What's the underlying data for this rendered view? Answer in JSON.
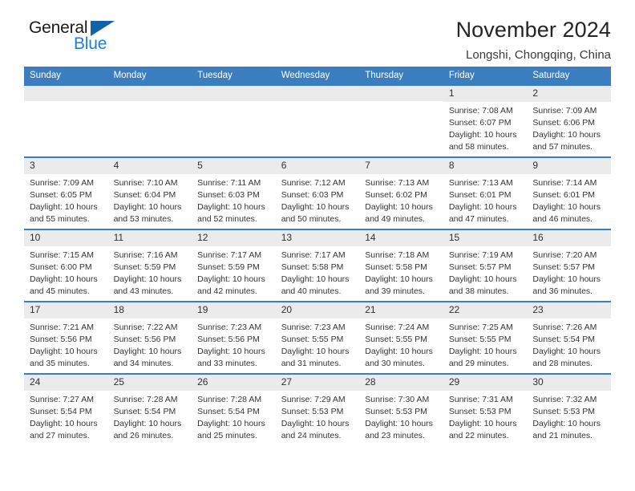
{
  "brand": {
    "name_part1": "General",
    "name_part2": "Blue",
    "triangle_color": "#1262ab",
    "blue_text_color": "#1f7fd0"
  },
  "header": {
    "title": "November 2024",
    "location": "Longshi, Chongqing, China"
  },
  "theme": {
    "header_blue": "#3b7ec0",
    "daynum_band": "#ebebeb",
    "text": "#333333"
  },
  "weekday_headers": [
    "Sunday",
    "Monday",
    "Tuesday",
    "Wednesday",
    "Thursday",
    "Friday",
    "Saturday"
  ],
  "labels": {
    "sunrise_prefix": "Sunrise: ",
    "sunset_prefix": "Sunset: ",
    "daylight_prefix": "Daylight: "
  },
  "weeks": [
    [
      {
        "day": "",
        "sunrise": "",
        "sunset": "",
        "daylight_line1": "",
        "daylight_line2": "",
        "empty": true
      },
      {
        "day": "",
        "sunrise": "",
        "sunset": "",
        "daylight_line1": "",
        "daylight_line2": "",
        "empty": true
      },
      {
        "day": "",
        "sunrise": "",
        "sunset": "",
        "daylight_line1": "",
        "daylight_line2": "",
        "empty": true
      },
      {
        "day": "",
        "sunrise": "",
        "sunset": "",
        "daylight_line1": "",
        "daylight_line2": "",
        "empty": true
      },
      {
        "day": "",
        "sunrise": "",
        "sunset": "",
        "daylight_line1": "",
        "daylight_line2": "",
        "empty": true
      },
      {
        "day": "1",
        "sunrise": "Sunrise: 7:08 AM",
        "sunset": "Sunset: 6:07 PM",
        "daylight_line1": "Daylight: 10 hours",
        "daylight_line2": "and 58 minutes."
      },
      {
        "day": "2",
        "sunrise": "Sunrise: 7:09 AM",
        "sunset": "Sunset: 6:06 PM",
        "daylight_line1": "Daylight: 10 hours",
        "daylight_line2": "and 57 minutes."
      }
    ],
    [
      {
        "day": "3",
        "sunrise": "Sunrise: 7:09 AM",
        "sunset": "Sunset: 6:05 PM",
        "daylight_line1": "Daylight: 10 hours",
        "daylight_line2": "and 55 minutes."
      },
      {
        "day": "4",
        "sunrise": "Sunrise: 7:10 AM",
        "sunset": "Sunset: 6:04 PM",
        "daylight_line1": "Daylight: 10 hours",
        "daylight_line2": "and 53 minutes."
      },
      {
        "day": "5",
        "sunrise": "Sunrise: 7:11 AM",
        "sunset": "Sunset: 6:03 PM",
        "daylight_line1": "Daylight: 10 hours",
        "daylight_line2": "and 52 minutes."
      },
      {
        "day": "6",
        "sunrise": "Sunrise: 7:12 AM",
        "sunset": "Sunset: 6:03 PM",
        "daylight_line1": "Daylight: 10 hours",
        "daylight_line2": "and 50 minutes."
      },
      {
        "day": "7",
        "sunrise": "Sunrise: 7:13 AM",
        "sunset": "Sunset: 6:02 PM",
        "daylight_line1": "Daylight: 10 hours",
        "daylight_line2": "and 49 minutes."
      },
      {
        "day": "8",
        "sunrise": "Sunrise: 7:13 AM",
        "sunset": "Sunset: 6:01 PM",
        "daylight_line1": "Daylight: 10 hours",
        "daylight_line2": "and 47 minutes."
      },
      {
        "day": "9",
        "sunrise": "Sunrise: 7:14 AM",
        "sunset": "Sunset: 6:01 PM",
        "daylight_line1": "Daylight: 10 hours",
        "daylight_line2": "and 46 minutes."
      }
    ],
    [
      {
        "day": "10",
        "sunrise": "Sunrise: 7:15 AM",
        "sunset": "Sunset: 6:00 PM",
        "daylight_line1": "Daylight: 10 hours",
        "daylight_line2": "and 45 minutes."
      },
      {
        "day": "11",
        "sunrise": "Sunrise: 7:16 AM",
        "sunset": "Sunset: 5:59 PM",
        "daylight_line1": "Daylight: 10 hours",
        "daylight_line2": "and 43 minutes."
      },
      {
        "day": "12",
        "sunrise": "Sunrise: 7:17 AM",
        "sunset": "Sunset: 5:59 PM",
        "daylight_line1": "Daylight: 10 hours",
        "daylight_line2": "and 42 minutes."
      },
      {
        "day": "13",
        "sunrise": "Sunrise: 7:17 AM",
        "sunset": "Sunset: 5:58 PM",
        "daylight_line1": "Daylight: 10 hours",
        "daylight_line2": "and 40 minutes."
      },
      {
        "day": "14",
        "sunrise": "Sunrise: 7:18 AM",
        "sunset": "Sunset: 5:58 PM",
        "daylight_line1": "Daylight: 10 hours",
        "daylight_line2": "and 39 minutes."
      },
      {
        "day": "15",
        "sunrise": "Sunrise: 7:19 AM",
        "sunset": "Sunset: 5:57 PM",
        "daylight_line1": "Daylight: 10 hours",
        "daylight_line2": "and 38 minutes."
      },
      {
        "day": "16",
        "sunrise": "Sunrise: 7:20 AM",
        "sunset": "Sunset: 5:57 PM",
        "daylight_line1": "Daylight: 10 hours",
        "daylight_line2": "and 36 minutes."
      }
    ],
    [
      {
        "day": "17",
        "sunrise": "Sunrise: 7:21 AM",
        "sunset": "Sunset: 5:56 PM",
        "daylight_line1": "Daylight: 10 hours",
        "daylight_line2": "and 35 minutes."
      },
      {
        "day": "18",
        "sunrise": "Sunrise: 7:22 AM",
        "sunset": "Sunset: 5:56 PM",
        "daylight_line1": "Daylight: 10 hours",
        "daylight_line2": "and 34 minutes."
      },
      {
        "day": "19",
        "sunrise": "Sunrise: 7:23 AM",
        "sunset": "Sunset: 5:56 PM",
        "daylight_line1": "Daylight: 10 hours",
        "daylight_line2": "and 33 minutes."
      },
      {
        "day": "20",
        "sunrise": "Sunrise: 7:23 AM",
        "sunset": "Sunset: 5:55 PM",
        "daylight_line1": "Daylight: 10 hours",
        "daylight_line2": "and 31 minutes."
      },
      {
        "day": "21",
        "sunrise": "Sunrise: 7:24 AM",
        "sunset": "Sunset: 5:55 PM",
        "daylight_line1": "Daylight: 10 hours",
        "daylight_line2": "and 30 minutes."
      },
      {
        "day": "22",
        "sunrise": "Sunrise: 7:25 AM",
        "sunset": "Sunset: 5:55 PM",
        "daylight_line1": "Daylight: 10 hours",
        "daylight_line2": "and 29 minutes."
      },
      {
        "day": "23",
        "sunrise": "Sunrise: 7:26 AM",
        "sunset": "Sunset: 5:54 PM",
        "daylight_line1": "Daylight: 10 hours",
        "daylight_line2": "and 28 minutes."
      }
    ],
    [
      {
        "day": "24",
        "sunrise": "Sunrise: 7:27 AM",
        "sunset": "Sunset: 5:54 PM",
        "daylight_line1": "Daylight: 10 hours",
        "daylight_line2": "and 27 minutes."
      },
      {
        "day": "25",
        "sunrise": "Sunrise: 7:28 AM",
        "sunset": "Sunset: 5:54 PM",
        "daylight_line1": "Daylight: 10 hours",
        "daylight_line2": "and 26 minutes."
      },
      {
        "day": "26",
        "sunrise": "Sunrise: 7:28 AM",
        "sunset": "Sunset: 5:54 PM",
        "daylight_line1": "Daylight: 10 hours",
        "daylight_line2": "and 25 minutes."
      },
      {
        "day": "27",
        "sunrise": "Sunrise: 7:29 AM",
        "sunset": "Sunset: 5:53 PM",
        "daylight_line1": "Daylight: 10 hours",
        "daylight_line2": "and 24 minutes."
      },
      {
        "day": "28",
        "sunrise": "Sunrise: 7:30 AM",
        "sunset": "Sunset: 5:53 PM",
        "daylight_line1": "Daylight: 10 hours",
        "daylight_line2": "and 23 minutes."
      },
      {
        "day": "29",
        "sunrise": "Sunrise: 7:31 AM",
        "sunset": "Sunset: 5:53 PM",
        "daylight_line1": "Daylight: 10 hours",
        "daylight_line2": "and 22 minutes."
      },
      {
        "day": "30",
        "sunrise": "Sunrise: 7:32 AM",
        "sunset": "Sunset: 5:53 PM",
        "daylight_line1": "Daylight: 10 hours",
        "daylight_line2": "and 21 minutes."
      }
    ]
  ]
}
